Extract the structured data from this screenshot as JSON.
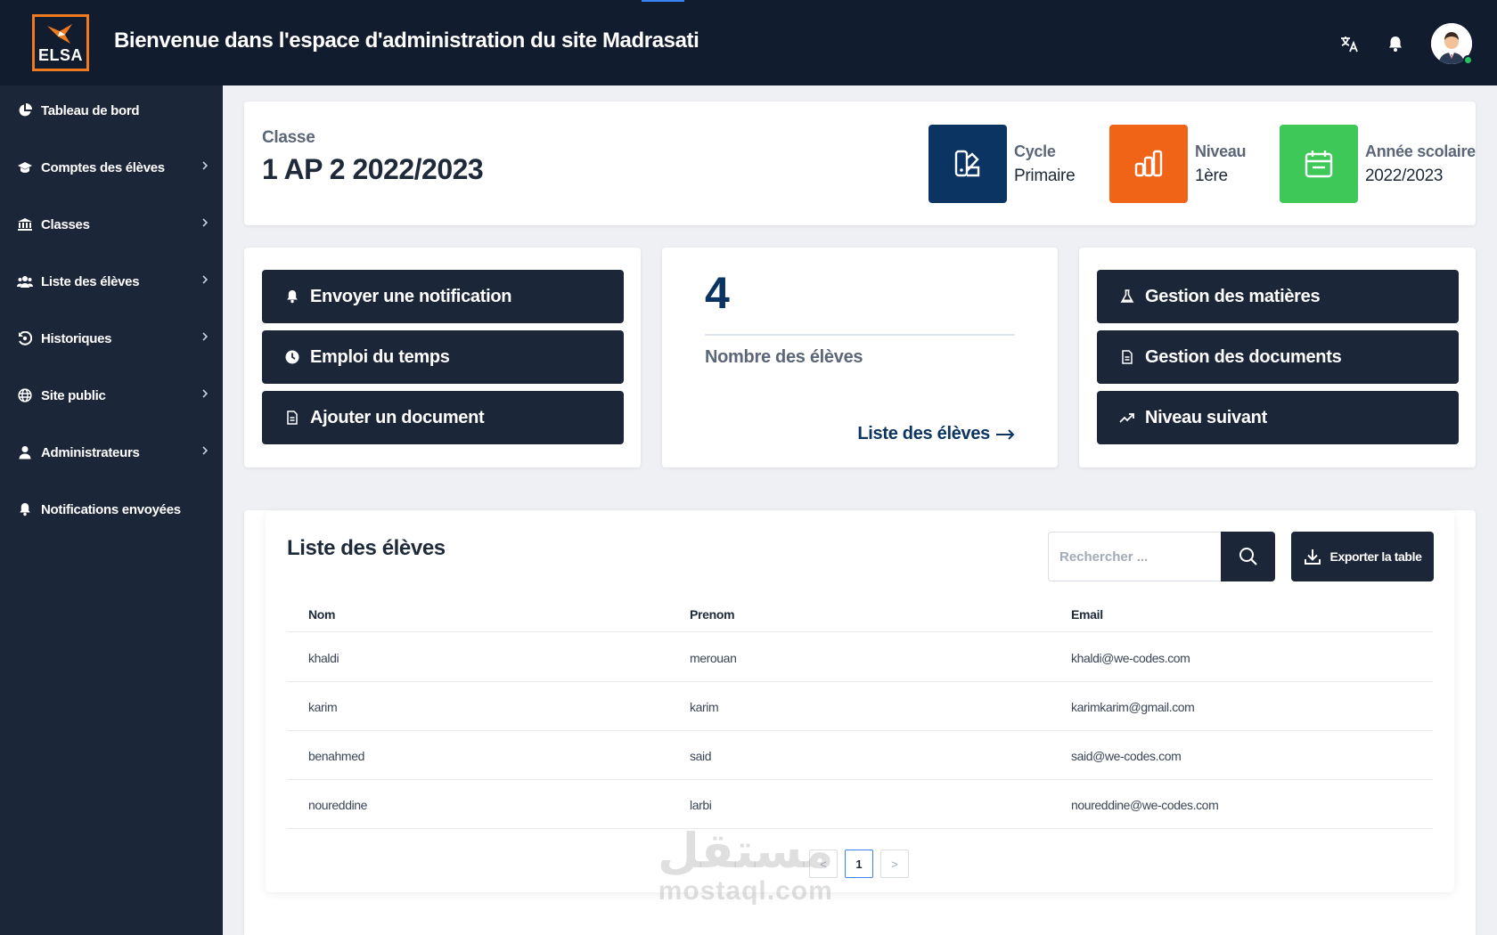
{
  "header": {
    "logo_text": "ELSA",
    "title": "Bienvenue dans l'espace d'administration du site Madrasati"
  },
  "sidebar": {
    "items": [
      {
        "label": "Tableau de bord",
        "icon": "pie-chart-icon"
      },
      {
        "label": "Comptes des élèves",
        "icon": "graduation-cap-icon"
      },
      {
        "label": "Classes",
        "icon": "bank-icon"
      },
      {
        "label": "Liste des élèves",
        "icon": "users-icon"
      },
      {
        "label": "Historiques",
        "icon": "history-icon"
      },
      {
        "label": "Site public",
        "icon": "globe-icon"
      },
      {
        "label": "Administrateurs",
        "icon": "user-icon"
      },
      {
        "label": "Notifications envoyées",
        "icon": "bell-icon"
      }
    ]
  },
  "class_info": {
    "label": "Classe",
    "name": "1 AP 2 2022/2023",
    "cycle": {
      "title": "Cycle",
      "value": "Primaire",
      "color": "#0b3463"
    },
    "niveau": {
      "title": "Niveau",
      "value": "1ère",
      "color": "#f06418"
    },
    "annee": {
      "title": "Année scolaire",
      "value": "2022/2023",
      "color": "#3ec858"
    }
  },
  "actions_left": [
    {
      "label": "Envoyer une notification",
      "icon": "bell-icon"
    },
    {
      "label": "Emploi du temps",
      "icon": "clock-icon"
    },
    {
      "label": "Ajouter un document",
      "icon": "document-icon"
    }
  ],
  "count_card": {
    "number": "4",
    "label": "Nombre des élèves",
    "link": "Liste des élèves"
  },
  "actions_right": [
    {
      "label": "Gestion des matières",
      "icon": "flask-icon"
    },
    {
      "label": "Gestion des documents",
      "icon": "document-icon"
    },
    {
      "label": "Niveau suivant",
      "icon": "trending-up-icon"
    }
  ],
  "students": {
    "title": "Liste des élèves",
    "search_placeholder": "Rechercher ...",
    "export_label": "Exporter la table",
    "columns": [
      "Nom",
      "Prenom",
      "Email"
    ],
    "rows": [
      [
        "khaldi",
        "merouan",
        "khaldi@we-codes.com"
      ],
      [
        "karim",
        "karim",
        "karimkarim@gmail.com"
      ],
      [
        "benahmed",
        "said",
        "said@we-codes.com"
      ],
      [
        "noureddine",
        "larbi",
        "noureddine@we-codes.com"
      ]
    ],
    "pagination": {
      "prev": "<",
      "current": "1",
      "next": ">"
    }
  },
  "watermark": {
    "arabic": "مستقل",
    "latin": "mostaql.com"
  }
}
